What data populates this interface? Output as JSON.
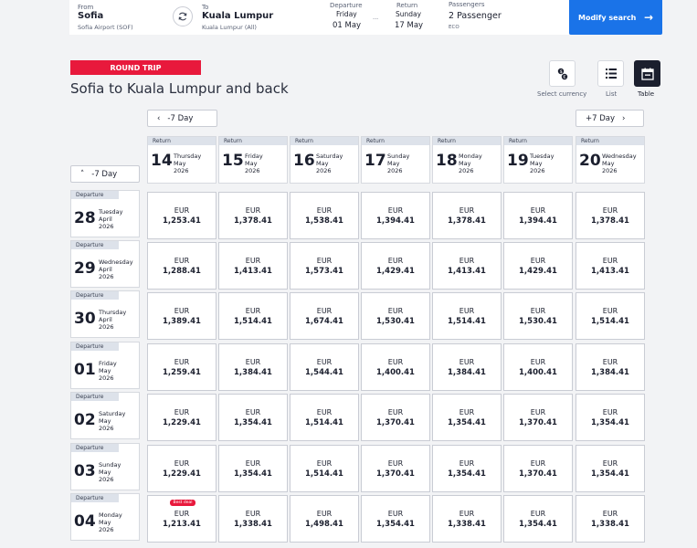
{
  "search": {
    "from_label": "From",
    "from_city": "Sofia",
    "from_airport": "Sofia Airport (SOF)",
    "to_label": "To",
    "to_city": "Kuala Lumpur",
    "to_airport": "Kuala Lumpur (All)",
    "departure_label": "Departure",
    "departure_day": "Friday",
    "departure_date": "01 May",
    "return_label": "Return",
    "return_day": "Sunday",
    "return_date": "17 May",
    "date_sep": "...",
    "passengers_label": "Passengers",
    "passengers": "2 Passenger",
    "cabin": "ECO",
    "modify_label": "Modify search"
  },
  "header": {
    "badge": "ROUND TRIP",
    "title": "Sofia to Kuala Lumpur and back",
    "views": [
      {
        "label": "Select currency",
        "icon": "currency-icon",
        "active": false
      },
      {
        "label": "List",
        "icon": "list-icon",
        "active": false
      },
      {
        "label": "Table",
        "icon": "calendar-icon",
        "active": true
      }
    ]
  },
  "nav": {
    "prev_return": "-7 Day",
    "next_return": "+7 Day",
    "prev_departure": "-7 Day"
  },
  "return_tag": "Return",
  "departure_tag": "Departure",
  "best_deal": "Best deal",
  "currency": "EUR",
  "returns": [
    {
      "num": "14",
      "day": "Thursday",
      "month": "May",
      "year": "2026"
    },
    {
      "num": "15",
      "day": "Friday",
      "month": "May",
      "year": "2026"
    },
    {
      "num": "16",
      "day": "Saturday",
      "month": "May",
      "year": "2026"
    },
    {
      "num": "17",
      "day": "Sunday",
      "month": "May",
      "year": "2026"
    },
    {
      "num": "18",
      "day": "Monday",
      "month": "May",
      "year": "2026"
    },
    {
      "num": "19",
      "day": "Tuesday",
      "month": "May",
      "year": "2026"
    },
    {
      "num": "20",
      "day": "Wednesday",
      "month": "May",
      "year": "2026"
    }
  ],
  "departures": [
    {
      "num": "28",
      "day": "Tuesday",
      "month": "April",
      "year": "2026",
      "prices": [
        "1,253.41",
        "1,378.41",
        "1,538.41",
        "1,394.41",
        "1,378.41",
        "1,394.41",
        "1,378.41"
      ]
    },
    {
      "num": "29",
      "day": "Wednesday",
      "month": "April",
      "year": "2026",
      "prices": [
        "1,288.41",
        "1,413.41",
        "1,573.41",
        "1,429.41",
        "1,413.41",
        "1,429.41",
        "1,413.41"
      ]
    },
    {
      "num": "30",
      "day": "Thursday",
      "month": "April",
      "year": "2026",
      "prices": [
        "1,389.41",
        "1,514.41",
        "1,674.41",
        "1,530.41",
        "1,514.41",
        "1,530.41",
        "1,514.41"
      ]
    },
    {
      "num": "01",
      "day": "Friday",
      "month": "May",
      "year": "2026",
      "prices": [
        "1,259.41",
        "1,384.41",
        "1,544.41",
        "1,400.41",
        "1,384.41",
        "1,400.41",
        "1,384.41"
      ]
    },
    {
      "num": "02",
      "day": "Saturday",
      "month": "May",
      "year": "2026",
      "prices": [
        "1,229.41",
        "1,354.41",
        "1,514.41",
        "1,370.41",
        "1,354.41",
        "1,370.41",
        "1,354.41"
      ]
    },
    {
      "num": "03",
      "day": "Sunday",
      "month": "May",
      "year": "2026",
      "prices": [
        "1,229.41",
        "1,354.41",
        "1,514.41",
        "1,370.41",
        "1,354.41",
        "1,370.41",
        "1,354.41"
      ]
    },
    {
      "num": "04",
      "day": "Monday",
      "month": "May",
      "year": "2026",
      "prices": [
        "1,213.41",
        "1,338.41",
        "1,498.41",
        "1,354.41",
        "1,338.41",
        "1,354.41",
        "1,338.41"
      ],
      "best_index": 0
    }
  ]
}
